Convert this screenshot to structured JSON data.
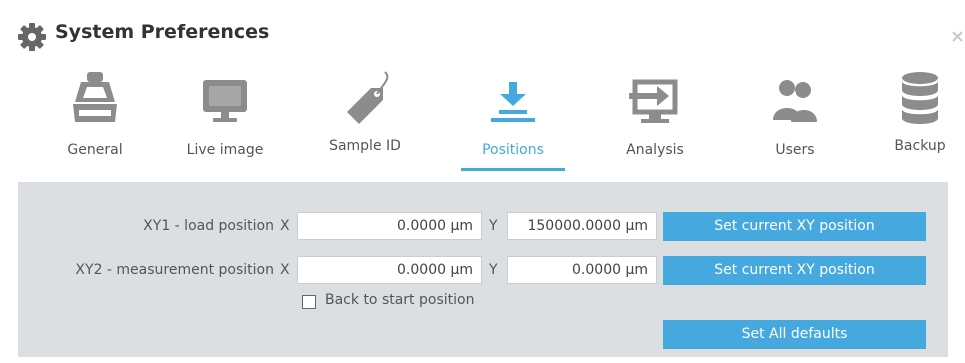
{
  "window": {
    "title": "System Preferences",
    "icon": "gear-icon",
    "close_icon": "close-icon"
  },
  "tabs": [
    {
      "label": "General",
      "icon": "microscope-icon",
      "active": false
    },
    {
      "label": "Live image",
      "icon": "monitor-icon",
      "active": false
    },
    {
      "label": "Sample ID",
      "icon": "tag-icon",
      "active": false
    },
    {
      "label": "Positions",
      "icon": "download-arrow-icon",
      "active": true
    },
    {
      "label": "Analysis",
      "icon": "export-screen-icon",
      "active": false
    },
    {
      "label": "Users",
      "icon": "users-icon",
      "active": false
    },
    {
      "label": "Backup",
      "icon": "database-icon",
      "active": false
    }
  ],
  "positions": {
    "rows": [
      {
        "label": "XY1 - load position",
        "x_axis": "X",
        "x_value": "0.0000 μm",
        "y_axis": "Y",
        "y_value": "150000.0000 μm",
        "button": "Set current XY position"
      },
      {
        "label": "XY2 - measurement position",
        "x_axis": "X",
        "x_value": "0.0000 μm",
        "y_axis": "Y",
        "y_value": "0.0000 μm",
        "button": "Set current XY position"
      }
    ],
    "back_to_start": {
      "label": "Back to start position",
      "checked": false
    },
    "defaults_button": "Set All defaults"
  },
  "colors": {
    "accent": "#45a9df",
    "panel": "#dcdfe1",
    "icon_gray": "#8c8c8c"
  }
}
